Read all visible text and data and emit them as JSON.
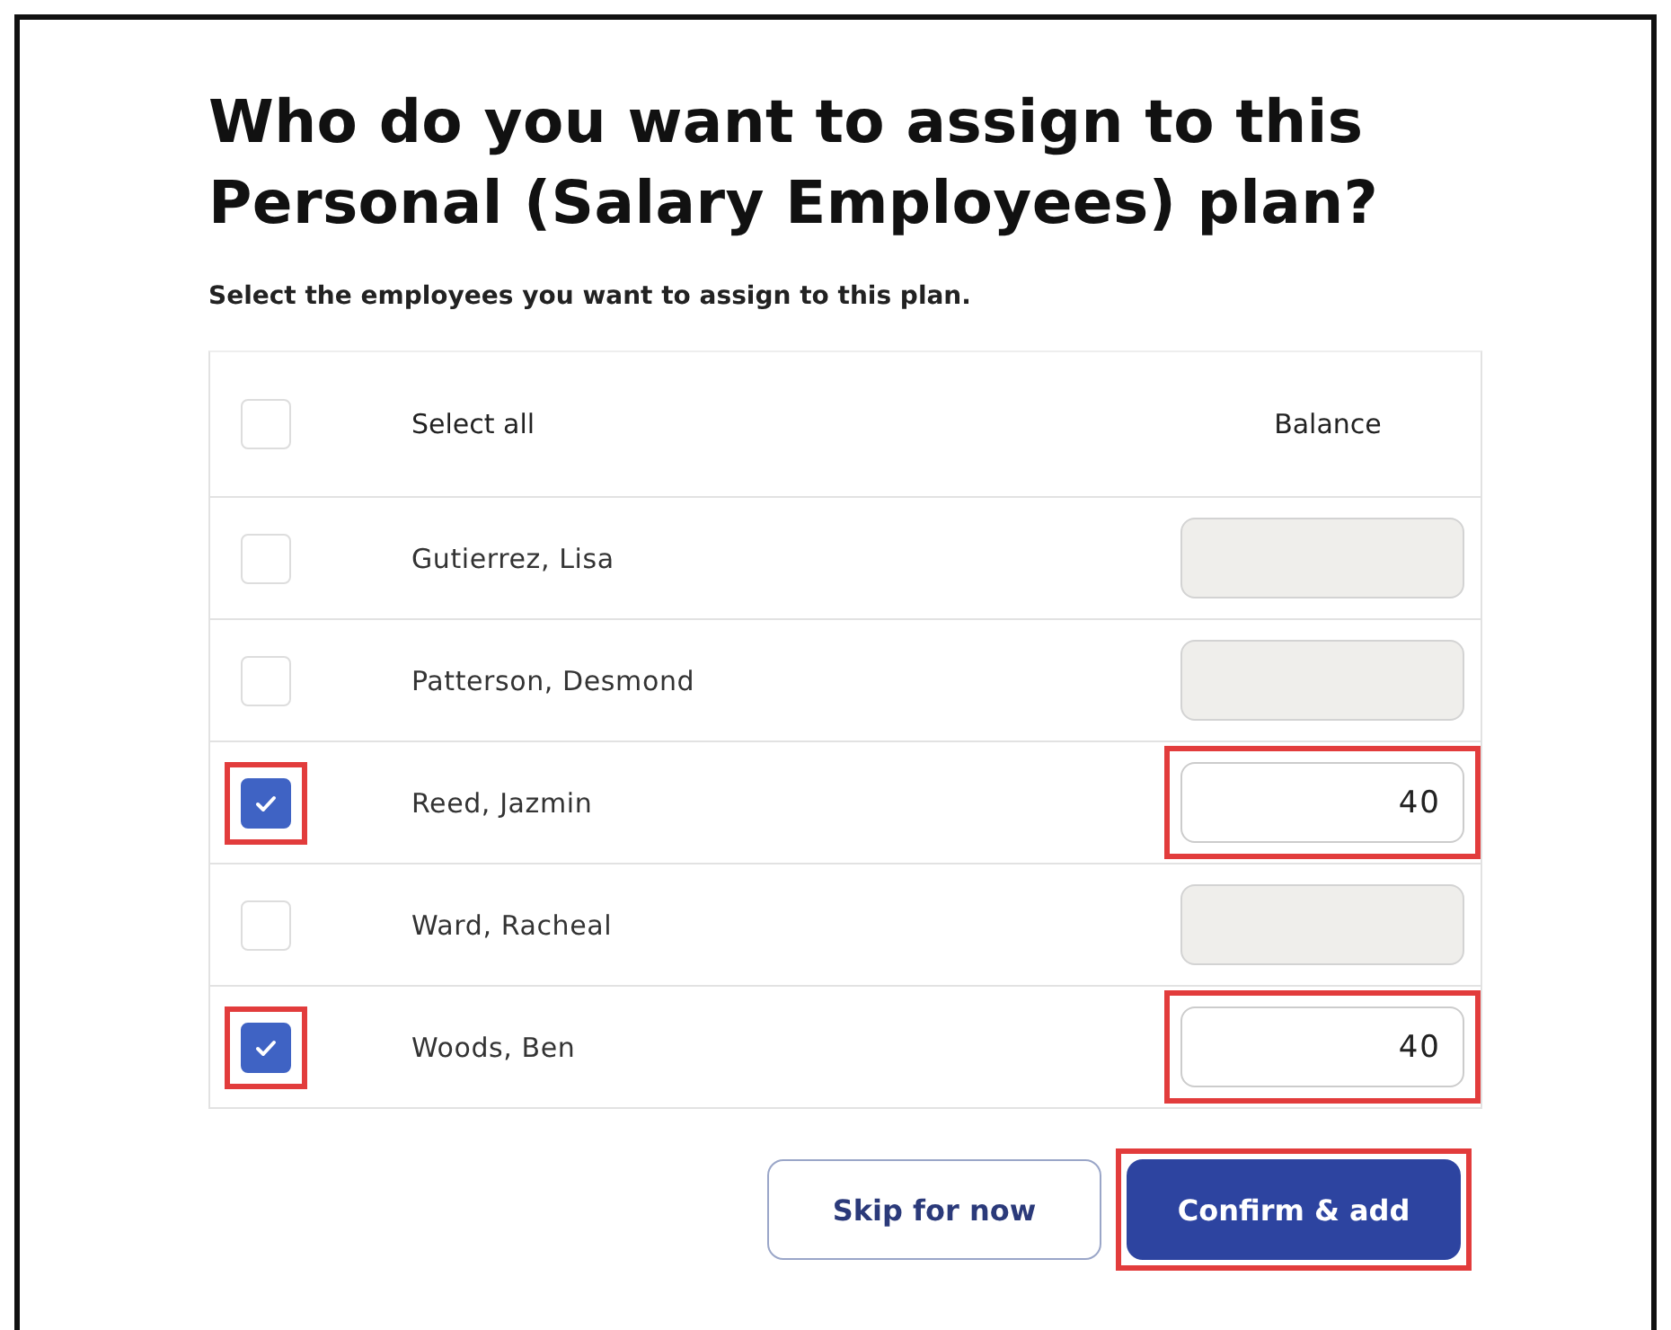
{
  "title": "Who do you want to assign to this Personal (Salary Employees) plan?",
  "subtitle": "Select the employees you want to assign to this plan.",
  "table": {
    "select_all": {
      "label": "Select all",
      "checked": false
    },
    "balance_header": "Balance",
    "rows": [
      {
        "name": "Gutierrez, Lisa",
        "checked": false,
        "highlighted": false,
        "balance": {
          "disabled": true
        }
      },
      {
        "name": "Patterson, Desmond",
        "checked": false,
        "highlighted": false,
        "balance": {
          "disabled": true
        }
      },
      {
        "name": "Reed, Jazmin",
        "checked": true,
        "highlighted": true,
        "balance": {
          "value": "40",
          "disabled": false
        }
      },
      {
        "name": "Ward, Racheal",
        "checked": false,
        "highlighted": false,
        "balance": {
          "disabled": true
        }
      },
      {
        "name": "Woods, Ben",
        "checked": true,
        "highlighted": true,
        "balance": {
          "value": "40",
          "disabled": false
        }
      }
    ]
  },
  "buttons": [
    {
      "label": "Skip for now",
      "kind": "secondary",
      "highlighted": false
    },
    {
      "label": "Confirm & add",
      "kind": "primary",
      "highlighted": true
    }
  ]
}
